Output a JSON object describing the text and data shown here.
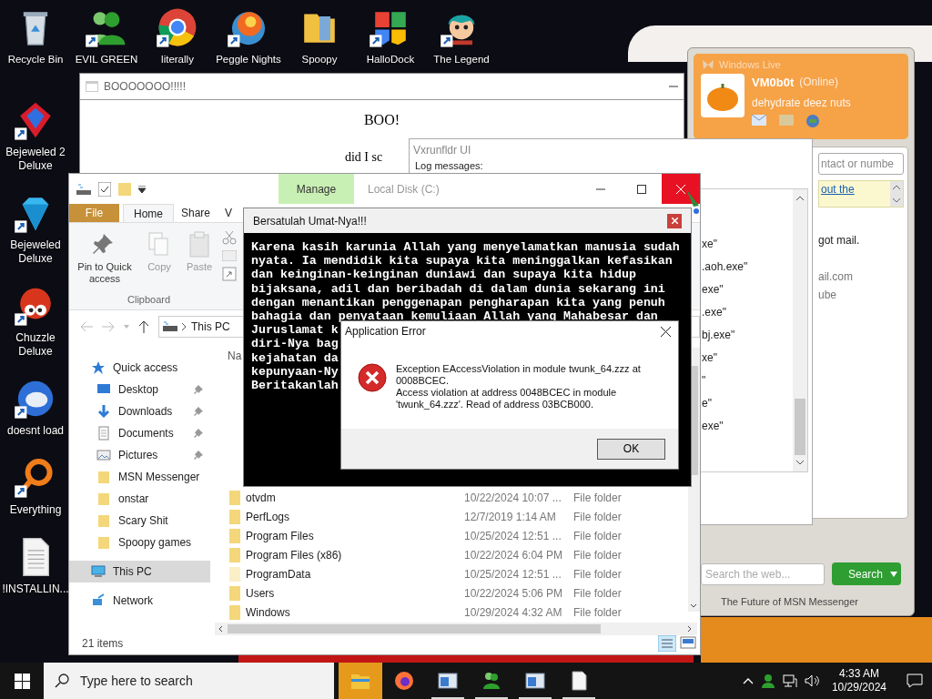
{
  "desktop": {
    "top_row": [
      {
        "label": "Recycle Bin",
        "kind": "recycle",
        "shortcut": false
      },
      {
        "label": "EVIL GREEN",
        "kind": "people",
        "shortcut": true
      },
      {
        "label": "literally",
        "kind": "browser",
        "shortcut": true
      },
      {
        "label": "Peggle Nights",
        "kind": "ball",
        "shortcut": true
      },
      {
        "label": "Spoopy",
        "kind": "folder",
        "shortcut": false
      },
      {
        "label": "HalloDock",
        "kind": "shield",
        "shortcut": true
      },
      {
        "label": "The Legend",
        "kind": "character",
        "shortcut": true
      }
    ],
    "left_column": [
      {
        "label": "Bejeweled 2 Deluxe",
        "kind": "gem",
        "shortcut": true
      },
      {
        "label": "Bejeweled Deluxe",
        "kind": "diamond",
        "shortcut": true
      },
      {
        "label": "Chuzzle Deluxe",
        "kind": "creature",
        "shortcut": true
      },
      {
        "label": "doesnt load",
        "kind": "bird",
        "shortcut": true
      },
      {
        "label": "Everything",
        "kind": "magnifier",
        "shortcut": true
      },
      {
        "label": "!INSTALLIN...",
        "kind": "document",
        "shortcut": false
      }
    ]
  },
  "boo_window": {
    "title": "BOOOOOOO!!!!!",
    "heading": "BOO!",
    "line": "did I sc"
  },
  "vxrunfldr_window": {
    "title": "Vxrunfldr UI",
    "log_label": "Log messages:",
    "log_lines": [
      "xe\"",
      ".aoh.exe\"",
      "exe\"",
      ".exe\"",
      "bj.exe\"",
      "xe\"",
      "\"",
      "e\"",
      "exe\""
    ]
  },
  "msn_window": {
    "title": "Windows Live",
    "display_name": "VM0b0t",
    "status": "(Online)",
    "personal_message": "dehydrate deez nuts",
    "contact_search_placeholder": "ntact or numbe",
    "banner_link": "out the",
    "items": [
      "got mail.",
      "ail.com",
      "ube"
    ],
    "web_search_placeholder": "Search the web...",
    "search_button": "Search",
    "footer": "The Future of MSN Messenger"
  },
  "explorer_window": {
    "title": "Local Disk (C:)",
    "context_tab": "Manage",
    "ribbon_tabs": [
      {
        "label": "File",
        "kind": "file",
        "selected": false
      },
      {
        "label": "Home",
        "kind": "tab",
        "selected": true
      },
      {
        "label": "Share",
        "kind": "tab",
        "selected": false
      },
      {
        "label": "V",
        "kind": "tab",
        "selected": false
      }
    ],
    "ribbon_buttons": [
      {
        "label": "Pin to Quick access",
        "kind": "pin",
        "disabled": false
      },
      {
        "label": "Copy",
        "kind": "copy",
        "disabled": true
      },
      {
        "label": "Paste",
        "kind": "paste",
        "disabled": true
      }
    ],
    "ribbon_group": "Clipboard",
    "address": "This PC",
    "nav": [
      {
        "label": "Quick access",
        "kind": "star",
        "selected": false,
        "children": [
          {
            "label": "Desktop",
            "kind": "desktop",
            "pinned": true,
            "selected": false
          },
          {
            "label": "Downloads",
            "kind": "download",
            "pinned": true,
            "selected": false
          },
          {
            "label": "Documents",
            "kind": "document",
            "pinned": true,
            "selected": false
          },
          {
            "label": "Pictures",
            "kind": "pictures",
            "pinned": true,
            "selected": false
          },
          {
            "label": "MSN Messenger",
            "kind": "folder",
            "pinned": false,
            "selected": false
          },
          {
            "label": "onstar",
            "kind": "folder",
            "pinned": false,
            "selected": false
          },
          {
            "label": "Scary Shit",
            "kind": "folder",
            "pinned": false,
            "selected": false
          },
          {
            "label": "Spoopy games",
            "kind": "folder",
            "pinned": false,
            "selected": false
          }
        ]
      },
      {
        "label": "This PC",
        "kind": "pc",
        "selected": true
      },
      {
        "label": "Network",
        "kind": "network",
        "selected": false
      }
    ],
    "column_header": "Na",
    "rows": [
      {
        "name": "otvdm",
        "date": "10/22/2024 10:07 ...",
        "type": "File folder",
        "hidden": false
      },
      {
        "name": "PerfLogs",
        "date": "12/7/2019 1:14 AM",
        "type": "File folder",
        "hidden": false
      },
      {
        "name": "Program Files",
        "date": "10/25/2024 12:51 ...",
        "type": "File folder",
        "hidden": false
      },
      {
        "name": "Program Files (x86)",
        "date": "10/22/2024 6:04 PM",
        "type": "File folder",
        "hidden": false
      },
      {
        "name": "ProgramData",
        "date": "10/25/2024 12:51 ...",
        "type": "File folder",
        "hidden": true
      },
      {
        "name": "Users",
        "date": "10/22/2024 5:06 PM",
        "type": "File folder",
        "hidden": false
      },
      {
        "name": "Windows",
        "date": "10/29/2024 4:32 AM",
        "type": "File folder",
        "hidden": false
      }
    ],
    "status": "21 items"
  },
  "console_window": {
    "title": "Bersatulah Umat-Nya!!!",
    "lines": [
      "Karena kasih karunia Allah yang menyelamatkan manusia sudah",
      "nyata. Ia mendidik kita supaya kita meninggalkan kefasikan",
      "dan keinginan-keinginan duniawi dan supaya kita hidup",
      "bijaksana, adil dan beribadah di dalam dunia sekarang ini",
      "dengan menantikan penggenapan pengharapan kita yang penuh",
      "bahagia dan penyataan kemuliaan Allah yang Mahabesar dan",
      "Juruslamat k",
      "diri-Nya bag",
      "kejahatan da",
      "kepunyaan-Ny",
      "Beritakanlah"
    ]
  },
  "error_dialog": {
    "title": "Application Error",
    "message_lines": [
      "Exception EAccessViolation in module twunk_64.zzz at 0008BCEC.",
      "Access violation at address 0048BCEC in module 'twunk_64.zzz'. Read of address 03BCB000."
    ],
    "button": "OK"
  },
  "taskbar": {
    "search_placeholder": "Type here to search",
    "apps": [
      {
        "kind": "folder",
        "running": false
      },
      {
        "kind": "firefox",
        "running": false
      },
      {
        "kind": "window",
        "running": true
      },
      {
        "kind": "people",
        "running": true
      },
      {
        "kind": "window",
        "running": true
      },
      {
        "kind": "document",
        "running": true
      }
    ],
    "time": "4:33 AM",
    "date": "10/29/2024"
  }
}
